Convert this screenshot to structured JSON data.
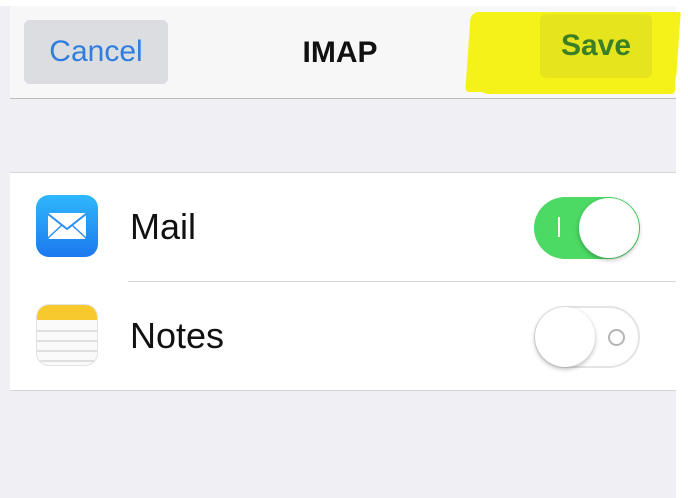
{
  "navbar": {
    "cancel_label": "Cancel",
    "title": "IMAP",
    "save_label": "Save"
  },
  "services": [
    {
      "label": "Mail",
      "icon": "mail-icon",
      "enabled": true
    },
    {
      "label": "Notes",
      "icon": "notes-icon",
      "enabled": false
    }
  ],
  "colors": {
    "accent_blue": "#2f7de0",
    "toggle_on": "#4cd964",
    "save_text": "#3a7f26",
    "highlight": "#f5f21a"
  }
}
